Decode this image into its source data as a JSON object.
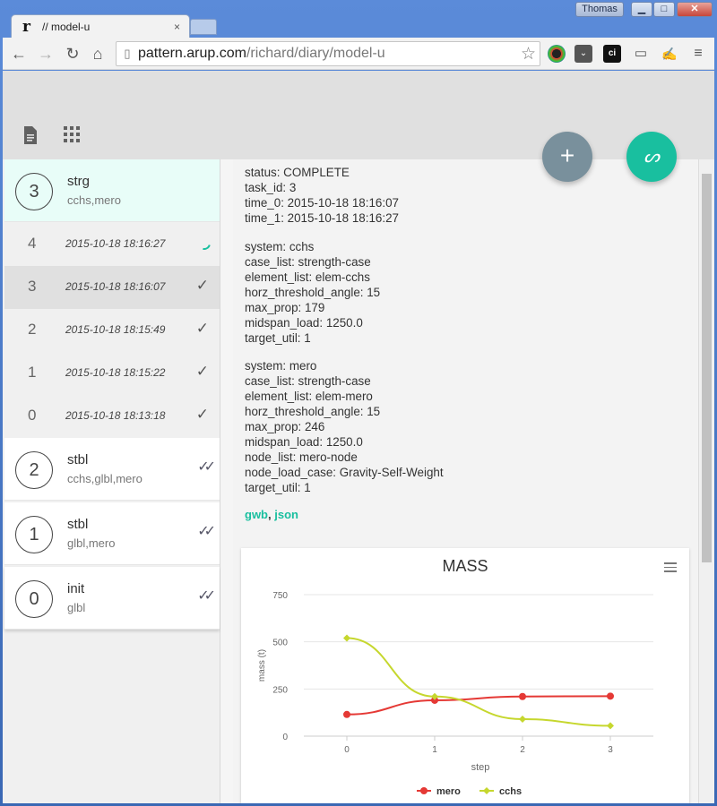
{
  "browser": {
    "tab_title": "// model-u",
    "tab_logo": "r",
    "tab_close": "×",
    "user": "Thomas",
    "window_buttons": {
      "minimize": "▁",
      "maximize": "□",
      "close": "✕"
    },
    "url_host": "pattern.arup.com",
    "url_path": "/richard/diary/model-u",
    "nav_icons": {
      "back": "←",
      "forward": "→",
      "reload": "↻",
      "home": "⌂"
    }
  },
  "header": {
    "icons": [
      "document-icon",
      "grid-icon"
    ],
    "fab_add": "+",
    "fab_sign": "ᔕ"
  },
  "sidebar": {
    "tasks_top": [
      {
        "num": "3",
        "title": "strg",
        "sub": "cchs,mero"
      }
    ],
    "runs": [
      {
        "num": "4",
        "date": "2015-10-18 18:16:27",
        "status": "running"
      },
      {
        "num": "3",
        "date": "2015-10-18 18:16:07",
        "status": "done"
      },
      {
        "num": "2",
        "date": "2015-10-18 18:15:49",
        "status": "done"
      },
      {
        "num": "1",
        "date": "2015-10-18 18:15:22",
        "status": "done"
      },
      {
        "num": "0",
        "date": "2015-10-18 18:13:18",
        "status": "done"
      }
    ],
    "tasks_bottom": [
      {
        "num": "2",
        "title": "stbl",
        "sub": "cchs,glbl,mero"
      },
      {
        "num": "1",
        "title": "stbl",
        "sub": "glbl,mero"
      },
      {
        "num": "0",
        "title": "init",
        "sub": "glbl"
      }
    ],
    "check_glyph": "✓",
    "double_check_glyph": "✓✓"
  },
  "detail": {
    "blocks": [
      [
        "status: COMPLETE",
        "task_id: 3",
        "time_0: 2015-10-18 18:16:07",
        "time_1: 2015-10-18 18:16:27"
      ],
      [
        "system: cchs",
        "case_list: strength-case",
        "element_list: elem-cchs",
        "horz_threshold_angle: 15",
        "max_prop: 179",
        "midspan_load: 1250.0",
        "target_util: 1"
      ],
      [
        "system: mero",
        "case_list: strength-case",
        "element_list: elem-mero",
        "horz_threshold_angle: 15",
        "max_prop: 246",
        "midspan_load: 1250.0",
        "node_list: mero-node",
        "node_load_case: Gravity-Self-Weight",
        "target_util: 1"
      ]
    ],
    "links": {
      "gwb": "gwb",
      "sep": ",",
      "json": "json"
    }
  },
  "colors": {
    "accent": "#19bf9f",
    "fab_grey": "#79909c",
    "mero": "#e53935",
    "cchs": "#c6d72e"
  },
  "chart_data": {
    "type": "line",
    "title": "MASS",
    "xlabel": "step",
    "ylabel": "mass (t)",
    "x": [
      0,
      1,
      2,
      3
    ],
    "ylim": [
      0,
      750
    ],
    "yticks": [
      0,
      250,
      500,
      750
    ],
    "grid": true,
    "legend": "bottom",
    "series": [
      {
        "name": "mero",
        "values": [
          115,
          190,
          210,
          212
        ],
        "color": "#e53935"
      },
      {
        "name": "cchs",
        "values": [
          520,
          210,
          90,
          55
        ],
        "color": "#c6d72e"
      }
    ]
  }
}
